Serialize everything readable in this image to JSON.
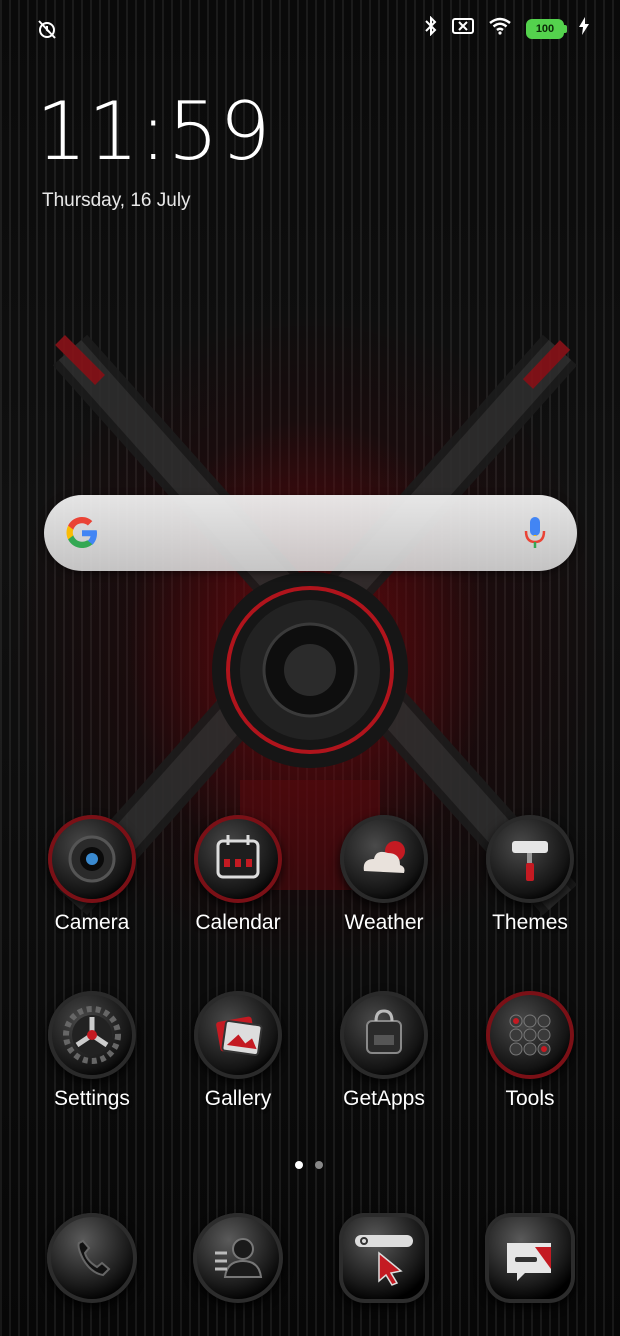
{
  "status_bar": {
    "left_icons": [
      "alarm-off-icon"
    ],
    "right_icons": [
      "bluetooth-icon",
      "no-sim-icon",
      "wifi-icon",
      "battery-icon",
      "charging-icon"
    ],
    "battery_level": "100"
  },
  "lockscreen": {
    "time": "11:59",
    "date": "Thursday, 16 July"
  },
  "search_bar": {
    "left_icon": "google-logo-icon",
    "right_icon": "microphone-icon"
  },
  "apps": [
    {
      "label": "Camera",
      "icon": "camera-icon"
    },
    {
      "label": "Calendar",
      "icon": "calendar-icon"
    },
    {
      "label": "Weather",
      "icon": "weather-icon"
    },
    {
      "label": "Themes",
      "icon": "paint-roller-icon"
    },
    {
      "label": "Settings",
      "icon": "gear-icon"
    },
    {
      "label": "Gallery",
      "icon": "gallery-icon"
    },
    {
      "label": "GetApps",
      "icon": "shopping-bag-icon"
    },
    {
      "label": "Tools",
      "icon": "tools-folder-icon"
    }
  ],
  "page_indicator": {
    "pages": 2,
    "active": 1
  },
  "dock": [
    {
      "icon": "phone-icon"
    },
    {
      "icon": "contacts-icon"
    },
    {
      "icon": "browser-icon"
    },
    {
      "icon": "messages-icon"
    }
  ],
  "colors": {
    "accent_red": "#c41a22",
    "battery_green": "#54d24d"
  }
}
